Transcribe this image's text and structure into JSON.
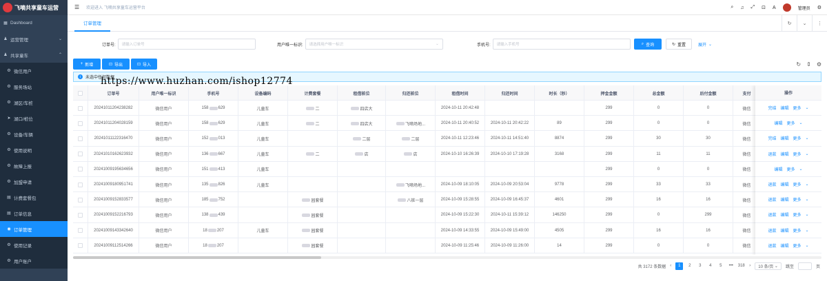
{
  "app": {
    "logo_text": "飞嘀共享童车运营",
    "welcome": "欢迎进入 飞嘀共享童车运营平台",
    "user": "管理员"
  },
  "sidebar": {
    "items": [
      {
        "label": "Dashboard",
        "icon": "dashboard-icon",
        "level": 0,
        "arrow": ""
      },
      {
        "label": "运营管理",
        "icon": "user-icon",
        "level": 0,
        "arrow": "⌄"
      },
      {
        "label": "共享童车",
        "icon": "user-icon",
        "level": 0,
        "arrow": "⌃"
      },
      {
        "label": "微信用户",
        "icon": "gear-icon",
        "level": 1,
        "arrow": ""
      },
      {
        "label": "服务场站",
        "icon": "gear-icon",
        "level": 1,
        "arrow": ""
      },
      {
        "label": "湖区/车桩",
        "icon": "gear-icon",
        "level": 1,
        "arrow": ""
      },
      {
        "label": "湖口/桩位",
        "icon": "send-icon",
        "level": 1,
        "arrow": ""
      },
      {
        "label": "设备/车辆",
        "icon": "gear-icon",
        "level": 1,
        "arrow": ""
      },
      {
        "label": "使用说明",
        "icon": "gear-icon",
        "level": 1,
        "arrow": ""
      },
      {
        "label": "故障上报",
        "icon": "gear-icon",
        "level": 1,
        "arrow": ""
      },
      {
        "label": "加盟申请",
        "icon": "gear-icon",
        "level": 1,
        "arrow": ""
      },
      {
        "label": "计费套餐包",
        "icon": "file-icon",
        "level": 1,
        "arrow": ""
      },
      {
        "label": "订单信息",
        "icon": "file-icon",
        "level": 1,
        "arrow": ""
      },
      {
        "label": "订单管理",
        "icon": "target-icon",
        "level": 1,
        "arrow": "",
        "active": true
      },
      {
        "label": "使用记录",
        "icon": "gear-icon",
        "level": 1,
        "arrow": ""
      },
      {
        "label": "用户账户",
        "icon": "gear-icon",
        "level": 1,
        "arrow": ""
      }
    ]
  },
  "tabs": {
    "active": "订单管理"
  },
  "watermark": "https://www.huzhan.com/ishop12774",
  "search": {
    "order_no_label": "订单号:",
    "order_no_placeholder": "请输入订单号",
    "uid_label": "用户唯一标识:",
    "uid_placeholder": "请选择用户唯一标识",
    "phone_label": "手机号:",
    "phone_placeholder": "请输入手机号",
    "search_btn": "查询",
    "reset_btn": "重置",
    "expand_btn": "展开"
  },
  "toolbar": {
    "add": "新增",
    "export": "导出",
    "import": "导入"
  },
  "alert": {
    "text": "未选中任何数据"
  },
  "table": {
    "columns": [
      "订单号",
      "用户唯一标识",
      "手机号",
      "设备编码",
      "计费套餐",
      "租借桩位",
      "归还桩位",
      "租借时间",
      "归还时间",
      "时长（秒）",
      "押金金额",
      "总金额",
      "后付金额",
      "支付"
    ],
    "ops_header": "操作",
    "rows": [
      {
        "order": "20241011204238282",
        "user": "微信用户",
        "phone": [
          "158",
          "629"
        ],
        "device": "儿童车",
        "plan": "二",
        "rent": "四店大",
        "ret": "",
        "t1": "2024-10-11 20:42:48",
        "t2": "",
        "dur": "",
        "dep": "299",
        "total": "0",
        "post": "0",
        "pay": "微信",
        "ops": [
          "完结",
          "编辑",
          "更多"
        ]
      },
      {
        "order": "20241011204028159",
        "user": "微信用户",
        "phone": [
          "158",
          "629"
        ],
        "device": "儿童车",
        "plan": "二",
        "rent": "四店大",
        "ret": "飞嘀场地...",
        "t1": "2024-10-11 20:40:52",
        "t2": "2024-10-11 20:42:22",
        "dur": "89",
        "dep": "299",
        "total": "0",
        "post": "0",
        "pay": "微信",
        "ops": [
          "编辑",
          "更多"
        ]
      },
      {
        "order": "20241011122316470",
        "user": "微信用户",
        "phone": [
          "152",
          "013"
        ],
        "device": "儿童车",
        "plan": "",
        "rent": "二层",
        "ret": "二层",
        "t1": "2024-10-11 12:23:46",
        "t2": "2024-10-11 14:51:40",
        "dur": "8874",
        "dep": "299",
        "total": "30",
        "post": "30",
        "pay": "微信",
        "ops": [
          "完结",
          "编辑",
          "更多"
        ]
      },
      {
        "order": "20241010162623932",
        "user": "微信用户",
        "phone": [
          "136",
          "667"
        ],
        "device": "儿童车",
        "plan": "二",
        "rent": "店",
        "ret": "店",
        "t1": "2024-10-10 16:26:39",
        "t2": "2024-10-10 17:19:28",
        "dur": "3168",
        "dep": "299",
        "total": "11",
        "post": "11",
        "pay": "微信",
        "ops": [
          "退款",
          "编辑",
          "更多"
        ]
      },
      {
        "order": "20241009195634656",
        "user": "微信用户",
        "phone": [
          "151",
          "413"
        ],
        "device": "儿童车",
        "plan": "",
        "rent": "",
        "ret": "",
        "t1": "",
        "t2": "",
        "dur": "",
        "dep": "299",
        "total": "0",
        "post": "0",
        "pay": "微信",
        "ops": [
          "编辑",
          "更多"
        ]
      },
      {
        "order": "20241009180951741",
        "user": "微信用户",
        "phone": [
          "135",
          "826"
        ],
        "device": "儿童车",
        "plan": "",
        "rent": "",
        "ret": "飞嘀场地...",
        "t1": "2024-10-09 18:10:05",
        "t2": "2024-10-09 20:53:04",
        "dur": "9778",
        "dep": "299",
        "total": "33",
        "post": "33",
        "pay": "微信",
        "ops": [
          "退款",
          "编辑",
          "更多"
        ]
      },
      {
        "order": "20241009152833577",
        "user": "微信用户",
        "phone": [
          "185",
          "752"
        ],
        "device": "",
        "plan": "园套餐",
        "rent": "",
        "ret": "八桩一层",
        "t1": "2024-10-09 15:28:55",
        "t2": "2024-10-09 16:45:37",
        "dur": "4601",
        "dep": "299",
        "total": "16",
        "post": "16",
        "pay": "微信",
        "ops": [
          "退款",
          "编辑",
          "更多"
        ]
      },
      {
        "order": "20241009152216793",
        "user": "微信用户",
        "phone": [
          "138",
          "439"
        ],
        "device": "",
        "plan": "园套餐",
        "rent": "",
        "ret": "",
        "t1": "2024-10-09 15:22:30",
        "t2": "2024-10-11 15:39:12",
        "dur": "146250",
        "dep": "299",
        "total": "0",
        "post": "299",
        "pay": "微信",
        "ops": [
          "退款",
          "编辑",
          "更多"
        ]
      },
      {
        "order": "20241009143342640",
        "user": "微信用户",
        "phone": [
          "18",
          "207"
        ],
        "device": "儿童车",
        "plan": "园套餐",
        "rent": "",
        "ret": "",
        "t1": "2024-10-09 14:33:55",
        "t2": "2024-10-09 15:49:00",
        "dur": "4505",
        "dep": "299",
        "total": "16",
        "post": "16",
        "pay": "微信",
        "ops": [
          "退款",
          "编辑",
          "更多"
        ]
      },
      {
        "order": "20241009112514266",
        "user": "微信用户",
        "phone": [
          "18",
          "207"
        ],
        "device": "",
        "plan": "园套餐",
        "rent": "",
        "ret": "",
        "t1": "2024-10-09 11:25:46",
        "t2": "2024-10-09 11:26:00",
        "dur": "14",
        "dep": "299",
        "total": "0",
        "post": "0",
        "pay": "微信",
        "ops": [
          "退款",
          "编辑",
          "更多"
        ]
      }
    ]
  },
  "pagination": {
    "total_text": "共 3172 条数据",
    "pages": [
      "1",
      "2",
      "3",
      "4",
      "5",
      "•••",
      "318"
    ],
    "current": "1",
    "size": "10 条/页",
    "jump_label": "跳至",
    "page_suffix": "页"
  }
}
